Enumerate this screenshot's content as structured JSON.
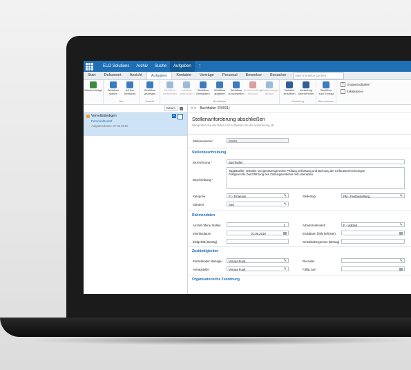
{
  "topnav": {
    "items": [
      "ELO Solutions",
      "Archiv",
      "Suche",
      "Aufgaben"
    ],
    "active_index": 3,
    "more": "⋮"
  },
  "tabs": {
    "items": [
      "Start",
      "Dokument",
      "Ansicht",
      "Aufgaben",
      "Kontakte",
      "Verträge",
      "Personal",
      "Bewerber",
      "Besucher"
    ],
    "active_index": 3,
    "search_placeholder": "Nach Funktion suchen"
  },
  "ribbon": {
    "groups": [
      {
        "name": "",
        "buttons": [
          {
            "label": "Wiedervorlage",
            "dim": false,
            "color": "#3d8b3d"
          }
        ]
      },
      {
        "name": "Neu",
        "buttons": [
          {
            "label": "Workflow starten",
            "dim": false,
            "color": "#3a7cc0"
          },
          {
            "label": "Ad-hoc Workflow",
            "dim": false,
            "color": "#3a7cc0"
          }
        ]
      },
      {
        "name": "Ansicht",
        "buttons": [
          {
            "label": "Workflow anzeigen",
            "dim": false,
            "color": "#3a7cc0"
          }
        ]
      },
      {
        "name": "Bearbeiten",
        "buttons": [
          {
            "label": "Workflow weiterleiten",
            "dim": true,
            "color": "#9bbbd9"
          },
          {
            "label": "Interflow abbrechen",
            "dim": true,
            "color": "#9bbbd9"
          },
          {
            "label": "Workflow übergeben",
            "dim": false,
            "color": "#3a7cc0"
          },
          {
            "label": "Workflow abgeben",
            "dim": false,
            "color": "#3a7cc0"
          },
          {
            "label": "Workflow zurückstellen",
            "dim": false,
            "color": "#3a7cc0"
          },
          {
            "label": "Zurückstellung löschen",
            "dim": true,
            "color": "#d9a0a0"
          },
          {
            "label": "Wiedervorlage ändern",
            "dim": true,
            "color": "#9bbbd9"
          }
        ]
      },
      {
        "name": "Vertretung",
        "buttons": [
          {
            "label": "Vertreter einsetzen",
            "dim": false,
            "color": "#2e5f99"
          },
          {
            "label": "Vertretung übernehmen",
            "dim": false,
            "color": "#2e5f99"
          }
        ]
      },
      {
        "name": "Übernommen",
        "buttons": [
          {
            "label": "Workflow zum Eintrag",
            "dim": false,
            "color": "#3a7cc0"
          }
        ]
      }
    ],
    "checks": [
      {
        "label": "Gruppenaufgaben",
        "checked": true
      },
      {
        "label": "Eskalationen",
        "checked": false
      }
    ]
  },
  "leftpanel": {
    "sort_label": "Datum",
    "task": {
      "title": "Vervollständigen",
      "subtitle": "Personalbedarf",
      "date": "Aufgabendatum: 27.03.2019",
      "badge": "A"
    }
  },
  "main": {
    "breadcrumb": "Buchhalter (R0001)",
    "nav_arrows": "«  »",
    "title": "Stellenanforderung abschließen",
    "hint": "Überprüfen Sie die Daten und schließen Sie die Anforderung ab.",
    "stellennummer_label": "Stellennummer",
    "stellennummer_value": "R0001",
    "sec_stellenbeschreibung": "Stellenbeschreibung",
    "bezeichnung_label": "Bezeichnung",
    "bezeichnung_value": "Buchhalter",
    "beschreibung_label": "Beschreibung",
    "beschreibung_value": "Tagaktueller, zeitnahe und gesetzesgerechte Prüfung, Erfassung und Buchung der Lieferantenrechnungen\nFristgerechte Durchführung des Zahlungsverkehrs mit Lieferanten",
    "kategorie_label": "Kategorie",
    "kategorie_value": "FI - Finanzen",
    "stellentyp_label": "Stellentyp",
    "stellentyp_value": "FM - Festanstellung",
    "standort_label": "Standort",
    "standort_value": "Süd",
    "sec_rahmendaten": "Rahmendaten",
    "anzahl_label": "Anzahl offene Stellen",
    "anzahl_value": "1",
    "arbeitszeit_label": "Arbeitszeitmodell",
    "arbeitszeit_value": "F - Vollzeit",
    "eintritt_label": "Eintrittsdatum",
    "eintritt_value": "01.06.2019",
    "enddatum_label": "Enddatum (falls befristet)",
    "enddatum_value": "",
    "zielgehalt_label": "Zielgehalt (Betrag)",
    "zielgehalt_value": "",
    "gehaltsobergrenze_label": "Gehaltsobergrenze (Betrag)",
    "gehaltsobergrenze_value": "",
    "sec_zustaendigkeiten": "Zuständigkeiten",
    "manager_label": "Einstellender Manager",
    "manager_value": "Verona Funk",
    "recruiter_label": "Recruiter",
    "recruiter_value": "",
    "antragsteller_label": "Antragsteller",
    "antragsteller_value": "Verona Funk",
    "faellig_label": "Fällig zum",
    "faellig_value": "",
    "sec_organisatorisch": "Organisatorische Zuordnung"
  }
}
